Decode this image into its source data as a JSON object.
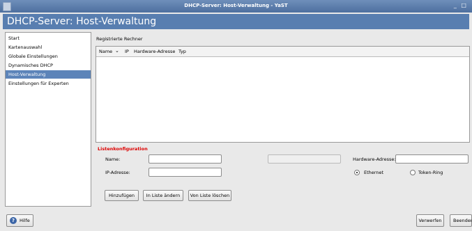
{
  "window": {
    "title": "DHCP-Server: Host-Verwaltung - YaST",
    "controls": "_ □"
  },
  "header": {
    "title": "DHCP-Server: Host-Verwaltung"
  },
  "sidebar": {
    "items": [
      {
        "label": "Start"
      },
      {
        "label": "Kartenauswahl"
      },
      {
        "label": "Globale Einstellungen"
      },
      {
        "label": "Dynamisches DHCP"
      },
      {
        "label": "Host-Verwaltung",
        "selected": true
      },
      {
        "label": "Einstellungen für Experten"
      }
    ]
  },
  "main": {
    "title": "Registrierte Rechner",
    "table": {
      "columns": [
        "Name",
        "IP",
        "Hardware-Adresse",
        "Typ"
      ],
      "sort_indicator": "chevron-down-icon",
      "rows": []
    },
    "list_config": {
      "title": "Listenkonfiguration",
      "name_label": "Name:",
      "name_value": "",
      "ip_label": "IP-Adresse:",
      "ip_value": "",
      "hw_label": "Hardware-Adresse:",
      "hw_value": "",
      "ethernet_label": "Ethernet",
      "tokenring_label": "Token-Ring",
      "selected_type": "Ethernet",
      "add_button": "Hinzufügen",
      "change_button": "In Liste ändern",
      "delete_button": "Von Liste löschen"
    }
  },
  "footer": {
    "help_button": "Hilfe",
    "discard_button": "Verwerfen",
    "finish_button": "Beenden"
  },
  "colors": {
    "header_bg": "#587eb0",
    "selection": "#5c84b9",
    "section_title": "#dd0000"
  }
}
